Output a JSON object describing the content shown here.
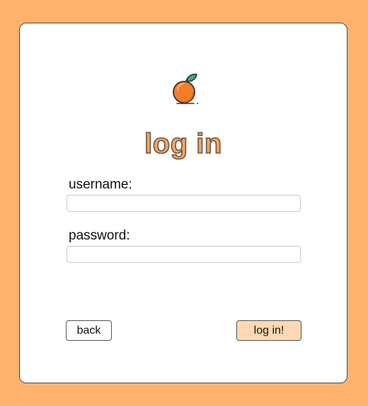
{
  "title": "log in",
  "logo": {
    "icon": "orange-fruit-icon"
  },
  "form": {
    "username_label": "username:",
    "username_value": "",
    "password_label": "password:",
    "password_value": ""
  },
  "buttons": {
    "back_label": "back",
    "login_label": "log in!"
  },
  "colors": {
    "background": "#FFB36D",
    "card": "#FFFFFF",
    "title_fill": "#F5A261",
    "login_button": "#FFD8B3"
  }
}
